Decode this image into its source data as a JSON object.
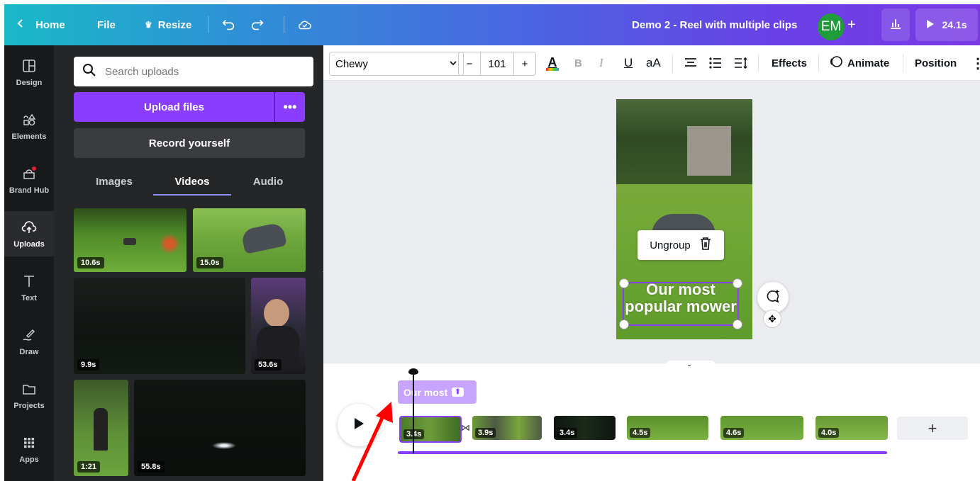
{
  "topbar": {
    "home_label": "Home",
    "file_label": "File",
    "resize_label": "Resize",
    "doc_title": "Demo 2 - Reel with multiple clips",
    "avatar_initials": "EM",
    "add_label": "+",
    "present_duration": "24.1s"
  },
  "rail": {
    "items": [
      {
        "label": "Design",
        "icon": "layout-icon"
      },
      {
        "label": "Elements",
        "icon": "shapes-icon"
      },
      {
        "label": "Brand Hub",
        "icon": "brand-icon"
      },
      {
        "label": "Uploads",
        "icon": "cloud-upload-icon"
      },
      {
        "label": "Text",
        "icon": "text-icon"
      },
      {
        "label": "Draw",
        "icon": "draw-icon"
      },
      {
        "label": "Projects",
        "icon": "folder-icon"
      },
      {
        "label": "Apps",
        "icon": "apps-grid-icon"
      }
    ]
  },
  "panel": {
    "search_placeholder": "Search uploads",
    "upload_label": "Upload files",
    "more_label": "•••",
    "record_label": "Record yourself",
    "tabs": [
      "Images",
      "Videos",
      "Audio"
    ],
    "videos": [
      {
        "duration": "10.6s"
      },
      {
        "duration": "15.0s"
      },
      {
        "duration": "9.9s"
      },
      {
        "duration": "53.6s"
      },
      {
        "duration": "1:21"
      },
      {
        "duration": "55.8s"
      }
    ]
  },
  "toolbar": {
    "font": "Chewy",
    "minus": "−",
    "size": "101",
    "plus": "+",
    "bold": "B",
    "italic": "I",
    "underline": "U",
    "case": "aA",
    "effects_label": "Effects",
    "animate_label": "Animate",
    "position_label": "Position"
  },
  "canvas": {
    "ungroup_label": "Ungroup",
    "caption": "Our most popular mower"
  },
  "timeline": {
    "text_track_label": "Our most",
    "clips": [
      {
        "duration": "3.4s"
      },
      {
        "duration": "3.9s"
      },
      {
        "duration": "3.4s"
      },
      {
        "duration": "4.5s"
      },
      {
        "duration": "4.6s"
      },
      {
        "duration": "4.0s"
      }
    ],
    "add_label": "+"
  },
  "colors": {
    "accent": "#8b3dff",
    "annotation_arrow": "#ff0000"
  }
}
